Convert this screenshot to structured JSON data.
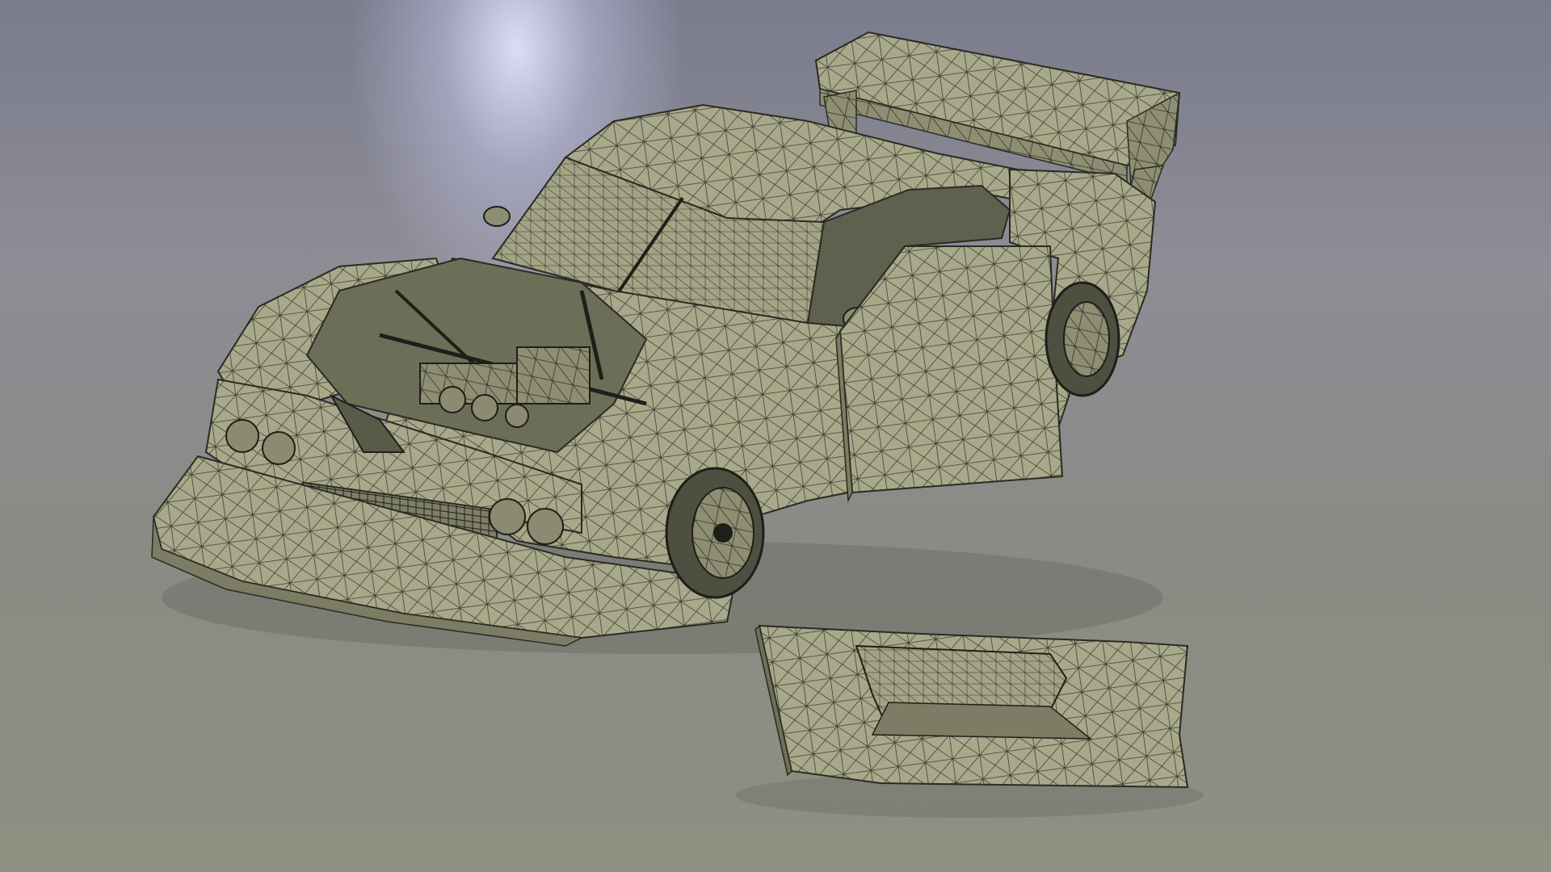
{
  "viewport": {
    "background_top": "#7a7b8c",
    "background_bottom": "#8e9082",
    "spotlight_color": "#e1e1ff"
  },
  "model": {
    "surface_color": "#a8a98a",
    "surface_shadow_color": "#6f7058",
    "wire_color": "#2a2b22",
    "parts": [
      "car-body",
      "rear-wing",
      "front-splitter",
      "open-door",
      "engine-bay",
      "front-wheel",
      "rear-wheel",
      "detached-hood"
    ]
  }
}
